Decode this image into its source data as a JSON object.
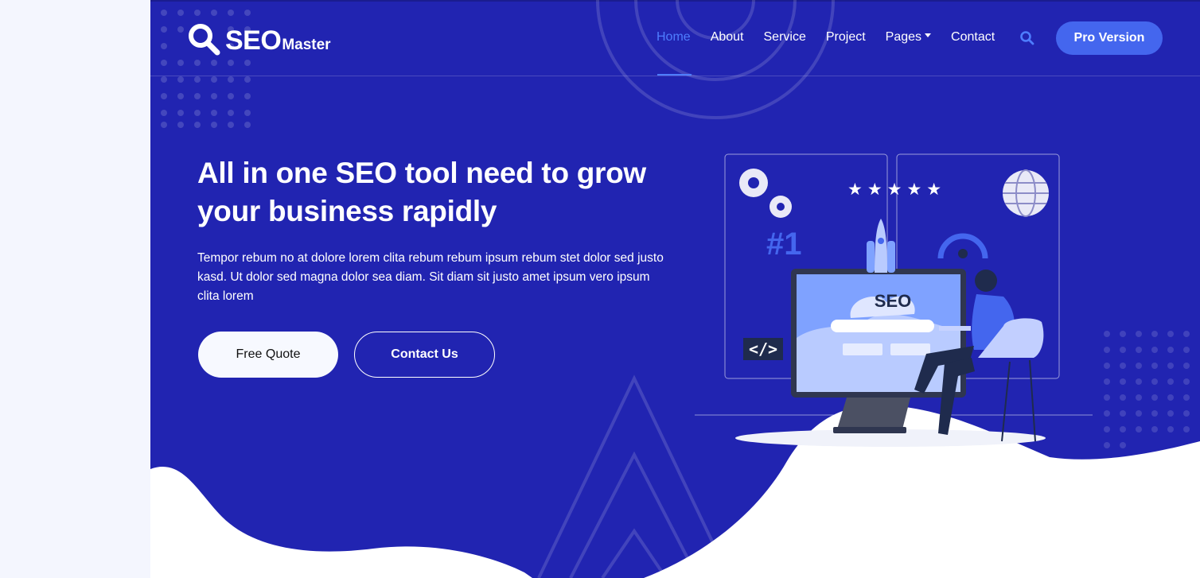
{
  "brand": {
    "name": "SEO",
    "suffix": "Master"
  },
  "nav": {
    "items": [
      {
        "label": "Home",
        "active": true
      },
      {
        "label": "About"
      },
      {
        "label": "Service"
      },
      {
        "label": "Project"
      },
      {
        "label": "Pages",
        "dropdown": true
      },
      {
        "label": "Contact"
      }
    ],
    "search_icon": "search-icon",
    "pro_label": "Pro Version"
  },
  "hero": {
    "headline": "All in one SEO tool need to grow your business rapidly",
    "paragraph": "Tempor rebum no at dolore lorem clita rebum rebum ipsum rebum stet dolor sed justo kasd. Ut dolor sed magna dolor sea diam. Sit diam sit justo amet ipsum vero ipsum clita lorem",
    "btn_quote": "Free Quote",
    "btn_contact": "Contact Us"
  },
  "illustration": {
    "seo_text": "SEO",
    "rank_text": "#1",
    "code_text": "</>",
    "stars_text": "★★★★★"
  },
  "colors": {
    "hero_bg": "#2124B1",
    "accent": "#4466EE",
    "active_link": "#4E7DFF",
    "page_bg": "#F4F6FE"
  }
}
